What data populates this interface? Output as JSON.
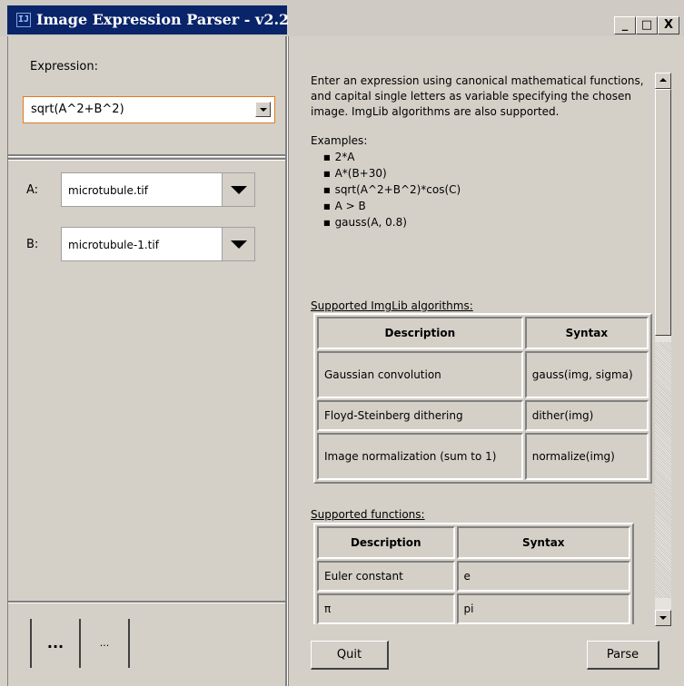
{
  "window": {
    "title": "Image Expression Parser - v2.2",
    "app_icon": "IJ",
    "minimize_label": "_",
    "maximize_label": "□",
    "close_label": "X"
  },
  "left": {
    "expression_label": "Expression:",
    "expression_value": "sqrt(A^2+B^2)",
    "variables": [
      {
        "letter": "A:",
        "image": "microtubule.tif"
      },
      {
        "letter": "B:",
        "image": "microtubule-1.tif"
      }
    ],
    "btn_add_label": "...",
    "btn_remove_label": "..."
  },
  "help": {
    "intro": "Enter an expression using canonical mathematical functions, and capital single letters as variable specifying the chosen image. ImgLib algorithms are also supported.",
    "examples_heading": "Examples:",
    "examples": [
      "2*A",
      "A*(B+30)",
      "sqrt(A^2+B^2)*cos(C)",
      "A > B",
      "gauss(A, 0.8)"
    ],
    "algorithms_heading": "Supported ImgLib algorithms:",
    "algorithms_headers": [
      "Description",
      "Syntax"
    ],
    "algorithms": [
      {
        "description": "Gaussian convolution",
        "syntax": "gauss(img, sigma)"
      },
      {
        "description": "Floyd-Steinberg dithering",
        "syntax": "dither(img)"
      },
      {
        "description": "Image normalization (sum to 1)",
        "syntax": "normalize(img)"
      }
    ],
    "functions_heading": "Supported functions:",
    "functions_headers": [
      "Description",
      "Syntax"
    ],
    "functions": [
      {
        "description": "Euler constant",
        "syntax": "e"
      },
      {
        "description": "π",
        "syntax": "pi"
      }
    ]
  },
  "buttons": {
    "quit": "Quit",
    "parse": "Parse"
  },
  "colors": {
    "title_active": "#0a246a",
    "face": "#d4d0c8",
    "focus_border": "#e07b1c"
  }
}
